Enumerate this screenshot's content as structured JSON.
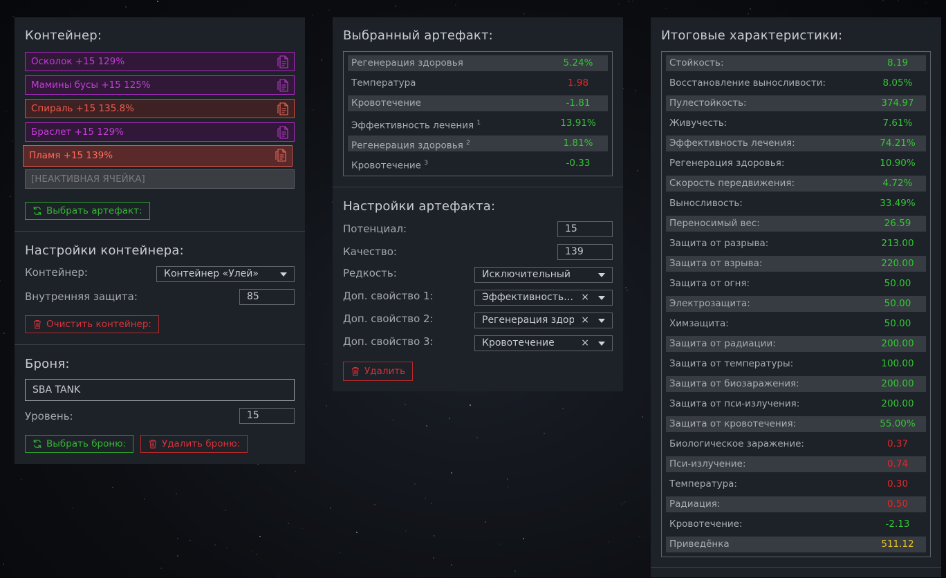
{
  "colors": {
    "green": "#32c832",
    "red": "#e02a2a",
    "yellow": "#e8c12a",
    "purple": "#c33cd8",
    "salmon": "#f05a4d"
  },
  "container": {
    "title": "Контейнер:",
    "slots": [
      {
        "label": "Осколок +15 129%",
        "style": "purple"
      },
      {
        "label": "Мамины бусы +15 125%",
        "style": "purple"
      },
      {
        "label": "Спираль +15 135.8%",
        "style": "red"
      },
      {
        "label": "Браслет +15 129%",
        "style": "purple"
      },
      {
        "label": "Пламя +15 139%",
        "style": "red-selected"
      },
      {
        "label": "[НЕАКТИВНАЯ ЯЧЕЙКА]",
        "style": "inactive"
      }
    ],
    "choose_button": "Выбрать артефакт:",
    "slot_icon": "document-icon"
  },
  "container_settings": {
    "title": "Настройки контейнера:",
    "container_label": "Контейнер:",
    "container_value": "Контейнер «Улей»",
    "protection_label": "Внутренняя защита:",
    "protection_value": "85",
    "clear_button": "Очистить контейнер:"
  },
  "armor": {
    "title": "Броня:",
    "name_value": "SBA TANK",
    "level_label": "Уровень:",
    "level_value": "15",
    "choose_button": "Выбрать броню:",
    "delete_button": "Удалить броню:"
  },
  "artifact": {
    "title": "Выбранный артефакт:",
    "stats": [
      {
        "k": "Регенерация здоровья",
        "sup": "",
        "v": "5.24%",
        "c": "g"
      },
      {
        "k": "Температура",
        "sup": "",
        "v": "1.98",
        "c": "r"
      },
      {
        "k": "Кровотечение",
        "sup": "",
        "v": "-1.81",
        "c": "g"
      },
      {
        "k": "Эффективность лечения",
        "sup": "1",
        "v": "13.91%",
        "c": "g"
      },
      {
        "k": "Регенерация здоровья",
        "sup": "2",
        "v": "1.81%",
        "c": "g"
      },
      {
        "k": "Кровотечение",
        "sup": "3",
        "v": "-0.33",
        "c": "g"
      }
    ]
  },
  "artifact_settings": {
    "title": "Настройки артефакта:",
    "potential_label": "Потенциал:",
    "potential_value": "15",
    "quality_label": "Качество:",
    "quality_value": "139",
    "rarity_label": "Редкость:",
    "rarity_value": "Исключительный",
    "prop1_label": "Доп. свойство 1:",
    "prop1_value": "Эффективность лечения",
    "prop2_label": "Доп. свойство 2:",
    "prop2_value": "Регенерация здоровья",
    "prop3_label": "Доп. свойство 3:",
    "prop3_value": "Кровотечение",
    "clear_symbol": "×",
    "delete_button": "Удалить"
  },
  "totals": {
    "title": "Итоговые характеристики:",
    "stats": [
      {
        "k": "Стойкость:",
        "v": "8.19",
        "c": "g"
      },
      {
        "k": "Восстановление выносливости:",
        "v": "8.05%",
        "c": "g"
      },
      {
        "k": "Пулестойкость:",
        "v": "374.97",
        "c": "g"
      },
      {
        "k": "Живучесть:",
        "v": "7.61%",
        "c": "g"
      },
      {
        "k": "Эффективность лечения:",
        "v": "74.21%",
        "c": "g"
      },
      {
        "k": "Регенерация здоровья:",
        "v": "10.90%",
        "c": "g"
      },
      {
        "k": "Скорость передвижения:",
        "v": "4.72%",
        "c": "g"
      },
      {
        "k": "Выносливость:",
        "v": "33.49%",
        "c": "g"
      },
      {
        "k": "Переносимый вес:",
        "v": "26.59",
        "c": "g"
      },
      {
        "k": "Защита от разрыва:",
        "v": "213.00",
        "c": "g"
      },
      {
        "k": "Защита от взрыва:",
        "v": "220.00",
        "c": "g"
      },
      {
        "k": "Защита от огня:",
        "v": "50.00",
        "c": "g"
      },
      {
        "k": "Электрозащита:",
        "v": "50.00",
        "c": "g"
      },
      {
        "k": "Химзащита:",
        "v": "50.00",
        "c": "g"
      },
      {
        "k": "Защита от радиации:",
        "v": "200.00",
        "c": "g"
      },
      {
        "k": "Защита от температуры:",
        "v": "100.00",
        "c": "g"
      },
      {
        "k": "Защита от биозаражения:",
        "v": "200.00",
        "c": "g"
      },
      {
        "k": "Защита от пси-излучения:",
        "v": "200.00",
        "c": "g"
      },
      {
        "k": "Защита от кровотечения:",
        "v": "55.00%",
        "c": "g"
      },
      {
        "k": "Биологическое заражение:",
        "v": "0.37",
        "c": "r"
      },
      {
        "k": "Пси-излучение:",
        "v": "0.74",
        "c": "r"
      },
      {
        "k": "Температура:",
        "v": "0.30",
        "c": "r"
      },
      {
        "k": "Радиация:",
        "v": "0.50",
        "c": "r"
      },
      {
        "k": "Кровотечение:",
        "v": "-2.13",
        "c": "g"
      },
      {
        "k": "Приведёнка",
        "v": "511.12",
        "c": "y"
      }
    ]
  }
}
